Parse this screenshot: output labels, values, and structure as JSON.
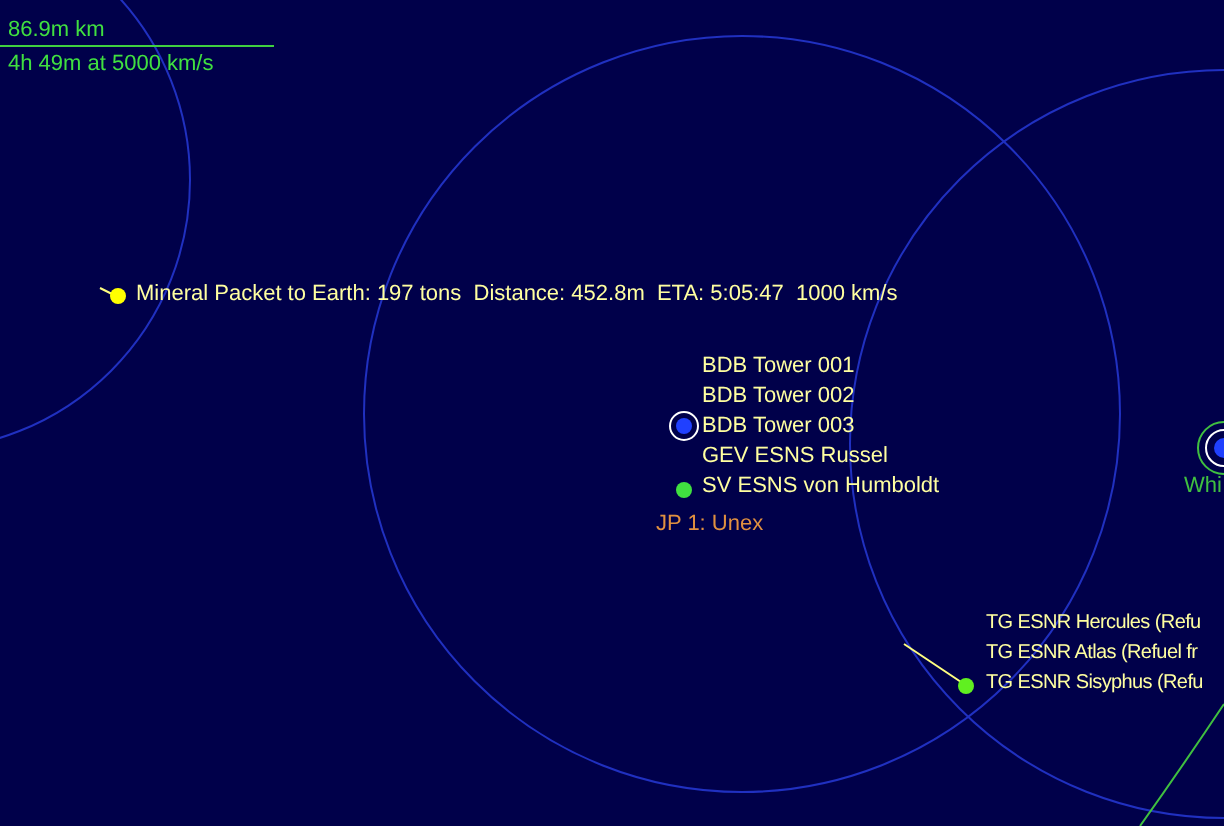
{
  "scale": {
    "distance": "86.9m km",
    "travel_time": "4h 49m at 5000 km/s"
  },
  "mineral_packet": {
    "label": "Mineral Packet to Earth: 197 tons  Distance: 452.8m  ETA: 5:05:47  1000 km/s"
  },
  "station_group": {
    "labels": [
      "BDB Tower 001",
      "BDB Tower 002",
      "BDB Tower 003",
      "GEV ESNS Russel",
      "SV ESNS von Humboldt"
    ]
  },
  "jump_point": {
    "label": "JP 1: Unex"
  },
  "fleet_group": {
    "labels": [
      "TG ESNR Hercules (Refu",
      "TG ESNR Atlas (Refuel fr",
      "TG ESNR Sisyphus (Refu"
    ]
  },
  "planet": {
    "label": "Whi"
  }
}
